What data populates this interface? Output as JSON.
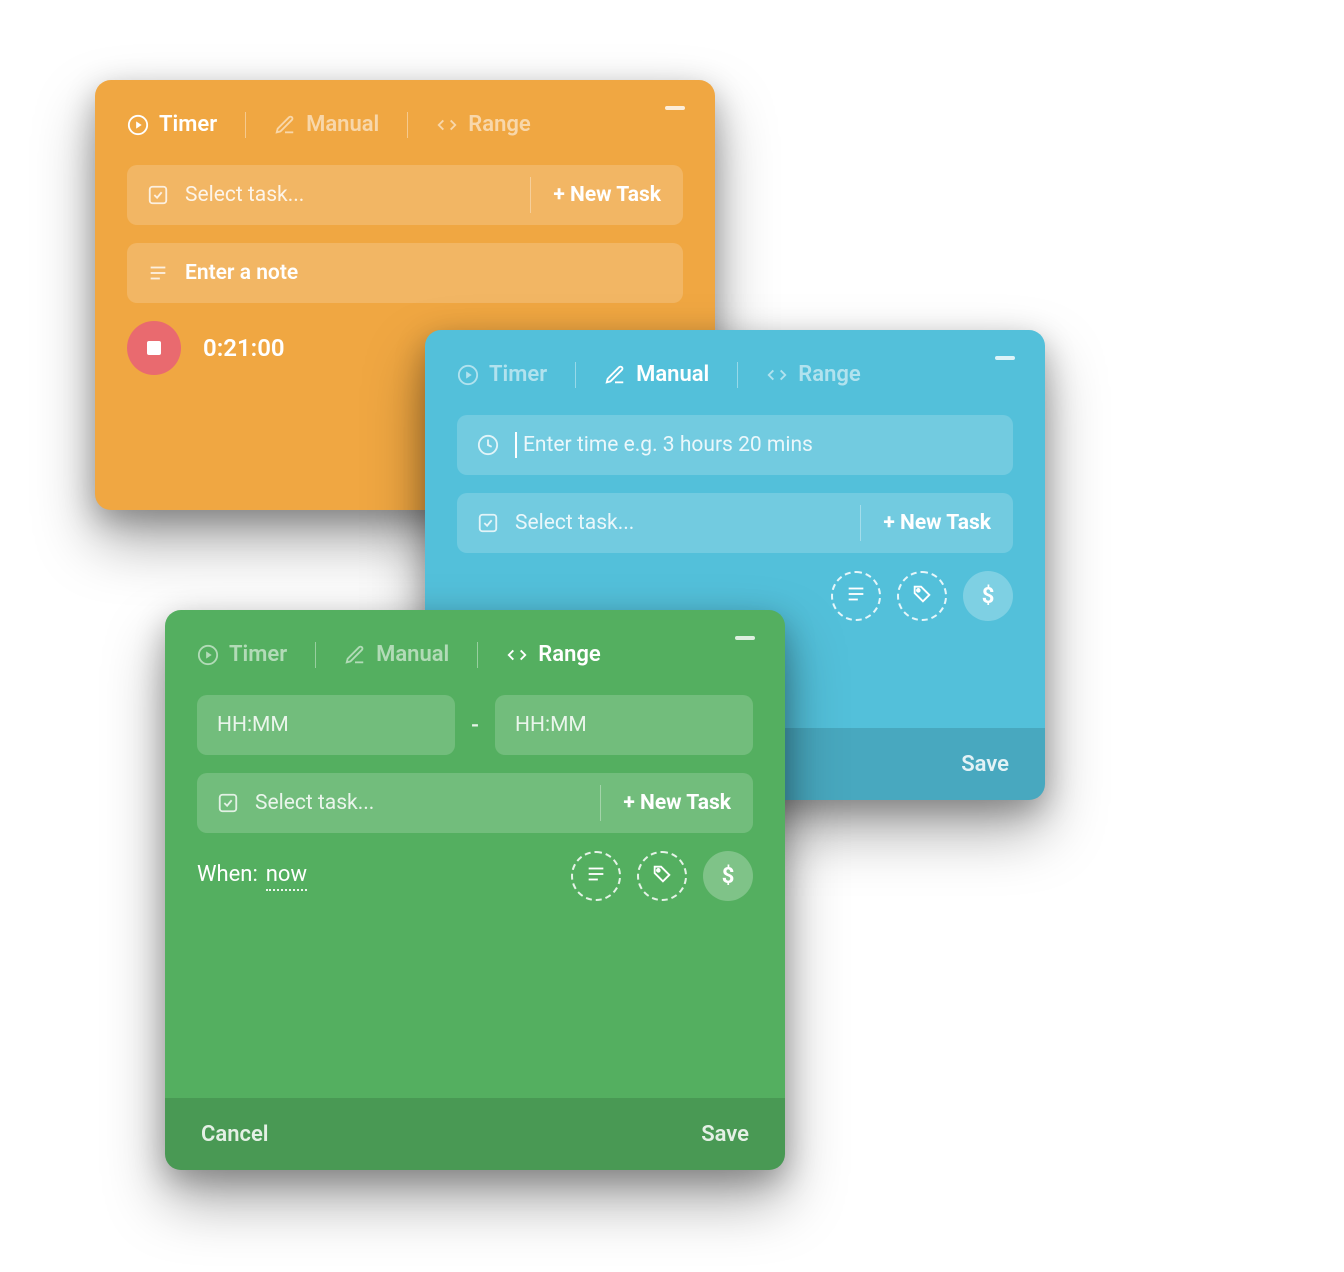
{
  "tabs": {
    "timer": "Timer",
    "manual": "Manual",
    "range": "Range"
  },
  "common": {
    "select_task": "Select task...",
    "new_task": "+ New Task",
    "cancel": "Cancel",
    "save": "Save",
    "dollar": "$"
  },
  "orange": {
    "note_placeholder": "Enter a note",
    "elapsed": "0:21:00"
  },
  "blue": {
    "time_placeholder": "Enter time e.g. 3 hours 20 mins"
  },
  "green": {
    "hhmm": "HH:MM",
    "dash": "-",
    "when_label": "When:",
    "when_value": "now"
  }
}
